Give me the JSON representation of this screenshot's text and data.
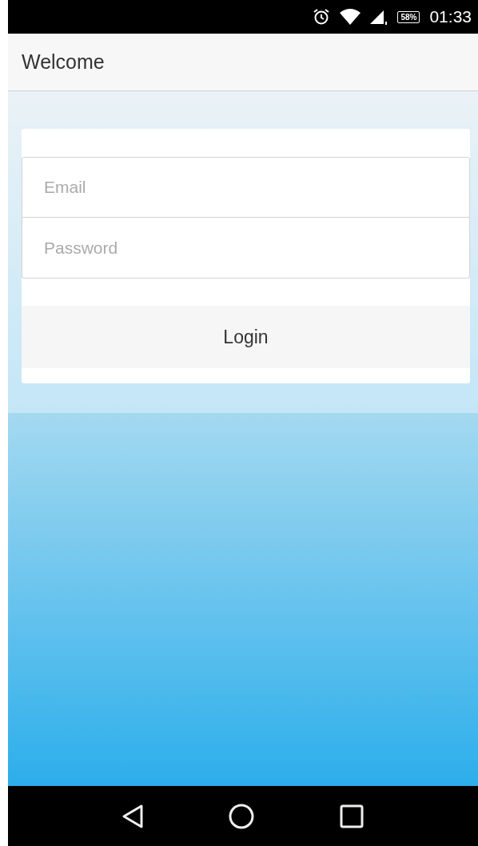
{
  "status_bar": {
    "battery": "58%",
    "time": "01:33"
  },
  "header": {
    "title": "Welcome"
  },
  "form": {
    "email": {
      "placeholder": "Email"
    },
    "password": {
      "placeholder": "Password"
    },
    "login_button": "Login"
  }
}
